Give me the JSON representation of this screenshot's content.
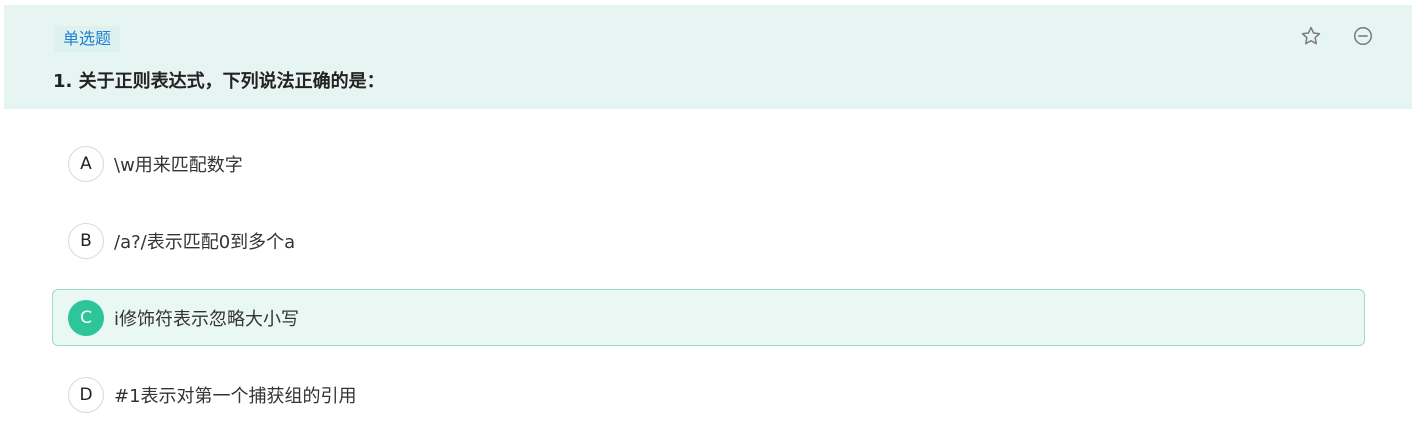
{
  "question": {
    "type_label": "单选题",
    "title": "1. 关于正则表达式，下列说法正确的是："
  },
  "actions": {
    "favorite_icon": "star-icon",
    "remove_icon": "minus-circle-icon"
  },
  "options": [
    {
      "letter": "A",
      "text": "\\w用来匹配数字",
      "selected": false
    },
    {
      "letter": "B",
      "text": "/a?/表示匹配0到多个a",
      "selected": false
    },
    {
      "letter": "C",
      "text": "i修饰符表示忽略大小写",
      "selected": true
    },
    {
      "letter": "D",
      "text": "#1表示对第一个捕获组的引用",
      "selected": false
    }
  ],
  "colors": {
    "header_bg": "#e6f5f2",
    "badge_text": "#1f7fd1",
    "selected_accent": "#2fc59a",
    "selected_bg": "#eaf8f4"
  }
}
